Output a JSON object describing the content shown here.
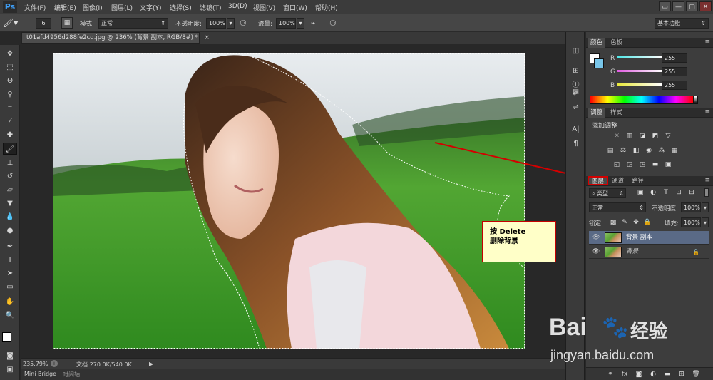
{
  "app": {
    "logo": "Ps"
  },
  "menu": [
    "文件(F)",
    "编辑(E)",
    "图像(I)",
    "图层(L)",
    "文字(Y)",
    "选择(S)",
    "滤镜(T)",
    "3D(D)",
    "视图(V)",
    "窗口(W)",
    "帮助(H)"
  ],
  "window_controls": [
    "▭",
    "—",
    "▢",
    "✕"
  ],
  "options": {
    "brush_size": "6",
    "mode_label": "模式:",
    "mode_value": "正常",
    "opacity_label": "不透明度:",
    "opacity_value": "100%",
    "flow_label": "流量:",
    "flow_value": "100%",
    "workspace": "基本功能"
  },
  "document": {
    "tab_title": "t01afd4956d288fe2cd.jpg @ 236% (背景 副本, RGB/8#) *",
    "close": "×"
  },
  "status": {
    "zoom": "235.79%",
    "doc_info": "文档:270.0K/540.0K"
  },
  "bottom_tabs": [
    "Mini Bridge",
    "时间轴"
  ],
  "color_panel": {
    "tabs": [
      "颜色",
      "色板"
    ],
    "channels": [
      {
        "label": "R",
        "value": "255",
        "color": "#4fe8e8"
      },
      {
        "label": "G",
        "value": "255",
        "color": "#e05be0"
      },
      {
        "label": "B",
        "value": "255",
        "color": "#e8e83a"
      }
    ]
  },
  "adjust_panel": {
    "tabs": [
      "调整",
      "样式"
    ],
    "title": "添加调整"
  },
  "layers_panel": {
    "tabs": [
      "图层",
      "通道",
      "路径"
    ],
    "filter_kind": "类型",
    "blend_mode": "正常",
    "opacity_label": "不透明度:",
    "opacity_value": "100%",
    "lock_label": "锁定:",
    "fill_label": "填充:",
    "fill_value": "100%",
    "layers": [
      {
        "name": "背景 副本",
        "selected": true
      },
      {
        "name": "背景",
        "locked": true
      }
    ]
  },
  "annotation": {
    "line1": "按 Delete",
    "line2": "删除背景"
  },
  "watermark": {
    "brand": "Bai",
    "brand2": "经验",
    "url": "jingyan.baidu.com"
  },
  "colors": {
    "highlight_red": "#d40000",
    "accent_blue": "#3fa3ff",
    "selected_layer": "#5a6a86"
  }
}
